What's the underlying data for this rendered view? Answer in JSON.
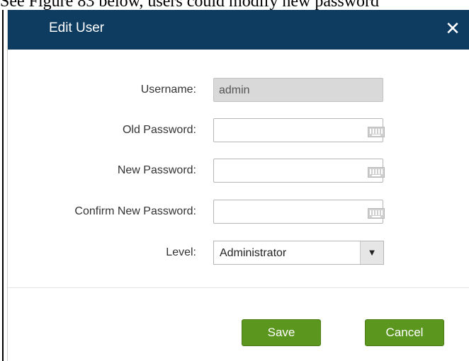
{
  "caption": "See Figure 83 below, users could modify new password",
  "dialog": {
    "title": "Edit User",
    "close_glyph": "✕",
    "fields": {
      "username": {
        "label": "Username:",
        "value": "admin"
      },
      "old_password": {
        "label": "Old Password:",
        "value": ""
      },
      "new_password": {
        "label": "New Password:",
        "value": ""
      },
      "confirm_password": {
        "label": "Confirm New Password:",
        "value": ""
      },
      "level": {
        "label": "Level:",
        "value": "Administrator",
        "arrow": "▼"
      }
    },
    "buttons": {
      "save": "Save",
      "cancel": "Cancel"
    },
    "colors": {
      "header": "#0e3b60",
      "button": "#5b961e"
    }
  }
}
